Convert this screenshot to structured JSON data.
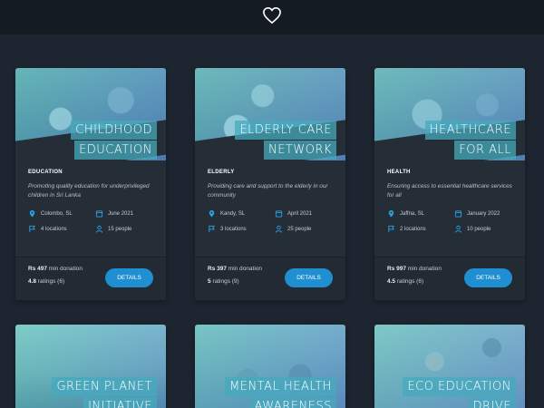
{
  "header": {
    "icon": "heart-icon"
  },
  "cards": [
    {
      "title1": "CHILDHOOD",
      "title2": "EDUCATION",
      "category": "EDUCATION",
      "description": "Promoting quality education for underprivileged children in Sri Lanka",
      "location": "Colombo, SL",
      "date": "June 2021",
      "locations": "4 locations",
      "people": "15 people",
      "price": "Rs 497",
      "price_suffix": "min donation",
      "rating": "4.8",
      "rating_suffix": "ratings (6)",
      "details": "DETAILS"
    },
    {
      "title1": "ELDERLY CARE",
      "title2": "NETWORK",
      "category": "ELDERLY",
      "description": "Providing care and support to the elderly in our community",
      "location": "Kandy, SL",
      "date": "April 2021",
      "locations": "3 locations",
      "people": "25 people",
      "price": "Rs 397",
      "price_suffix": "min donation",
      "rating": "5",
      "rating_suffix": "ratings (9)",
      "details": "DETAILS"
    },
    {
      "title1": "HEALTHCARE",
      "title2": "FOR ALL",
      "category": "HEALTH",
      "description": "Ensuring access to essential healthcare services for all",
      "location": "Jaffna, SL",
      "date": "January 2022",
      "locations": "2 locations",
      "people": "10 people",
      "price": "Rs 997",
      "price_suffix": "min donation",
      "rating": "4.5",
      "rating_suffix": "ratings (6)",
      "details": "DETAILS"
    },
    {
      "title1": "GREEN PLANET",
      "title2": "INITIATIVE"
    },
    {
      "title1": "MENTAL HEALTH",
      "title2": "AWARENESS"
    },
    {
      "title1": "ECO EDUCATION",
      "title2": "DRIVE"
    }
  ]
}
